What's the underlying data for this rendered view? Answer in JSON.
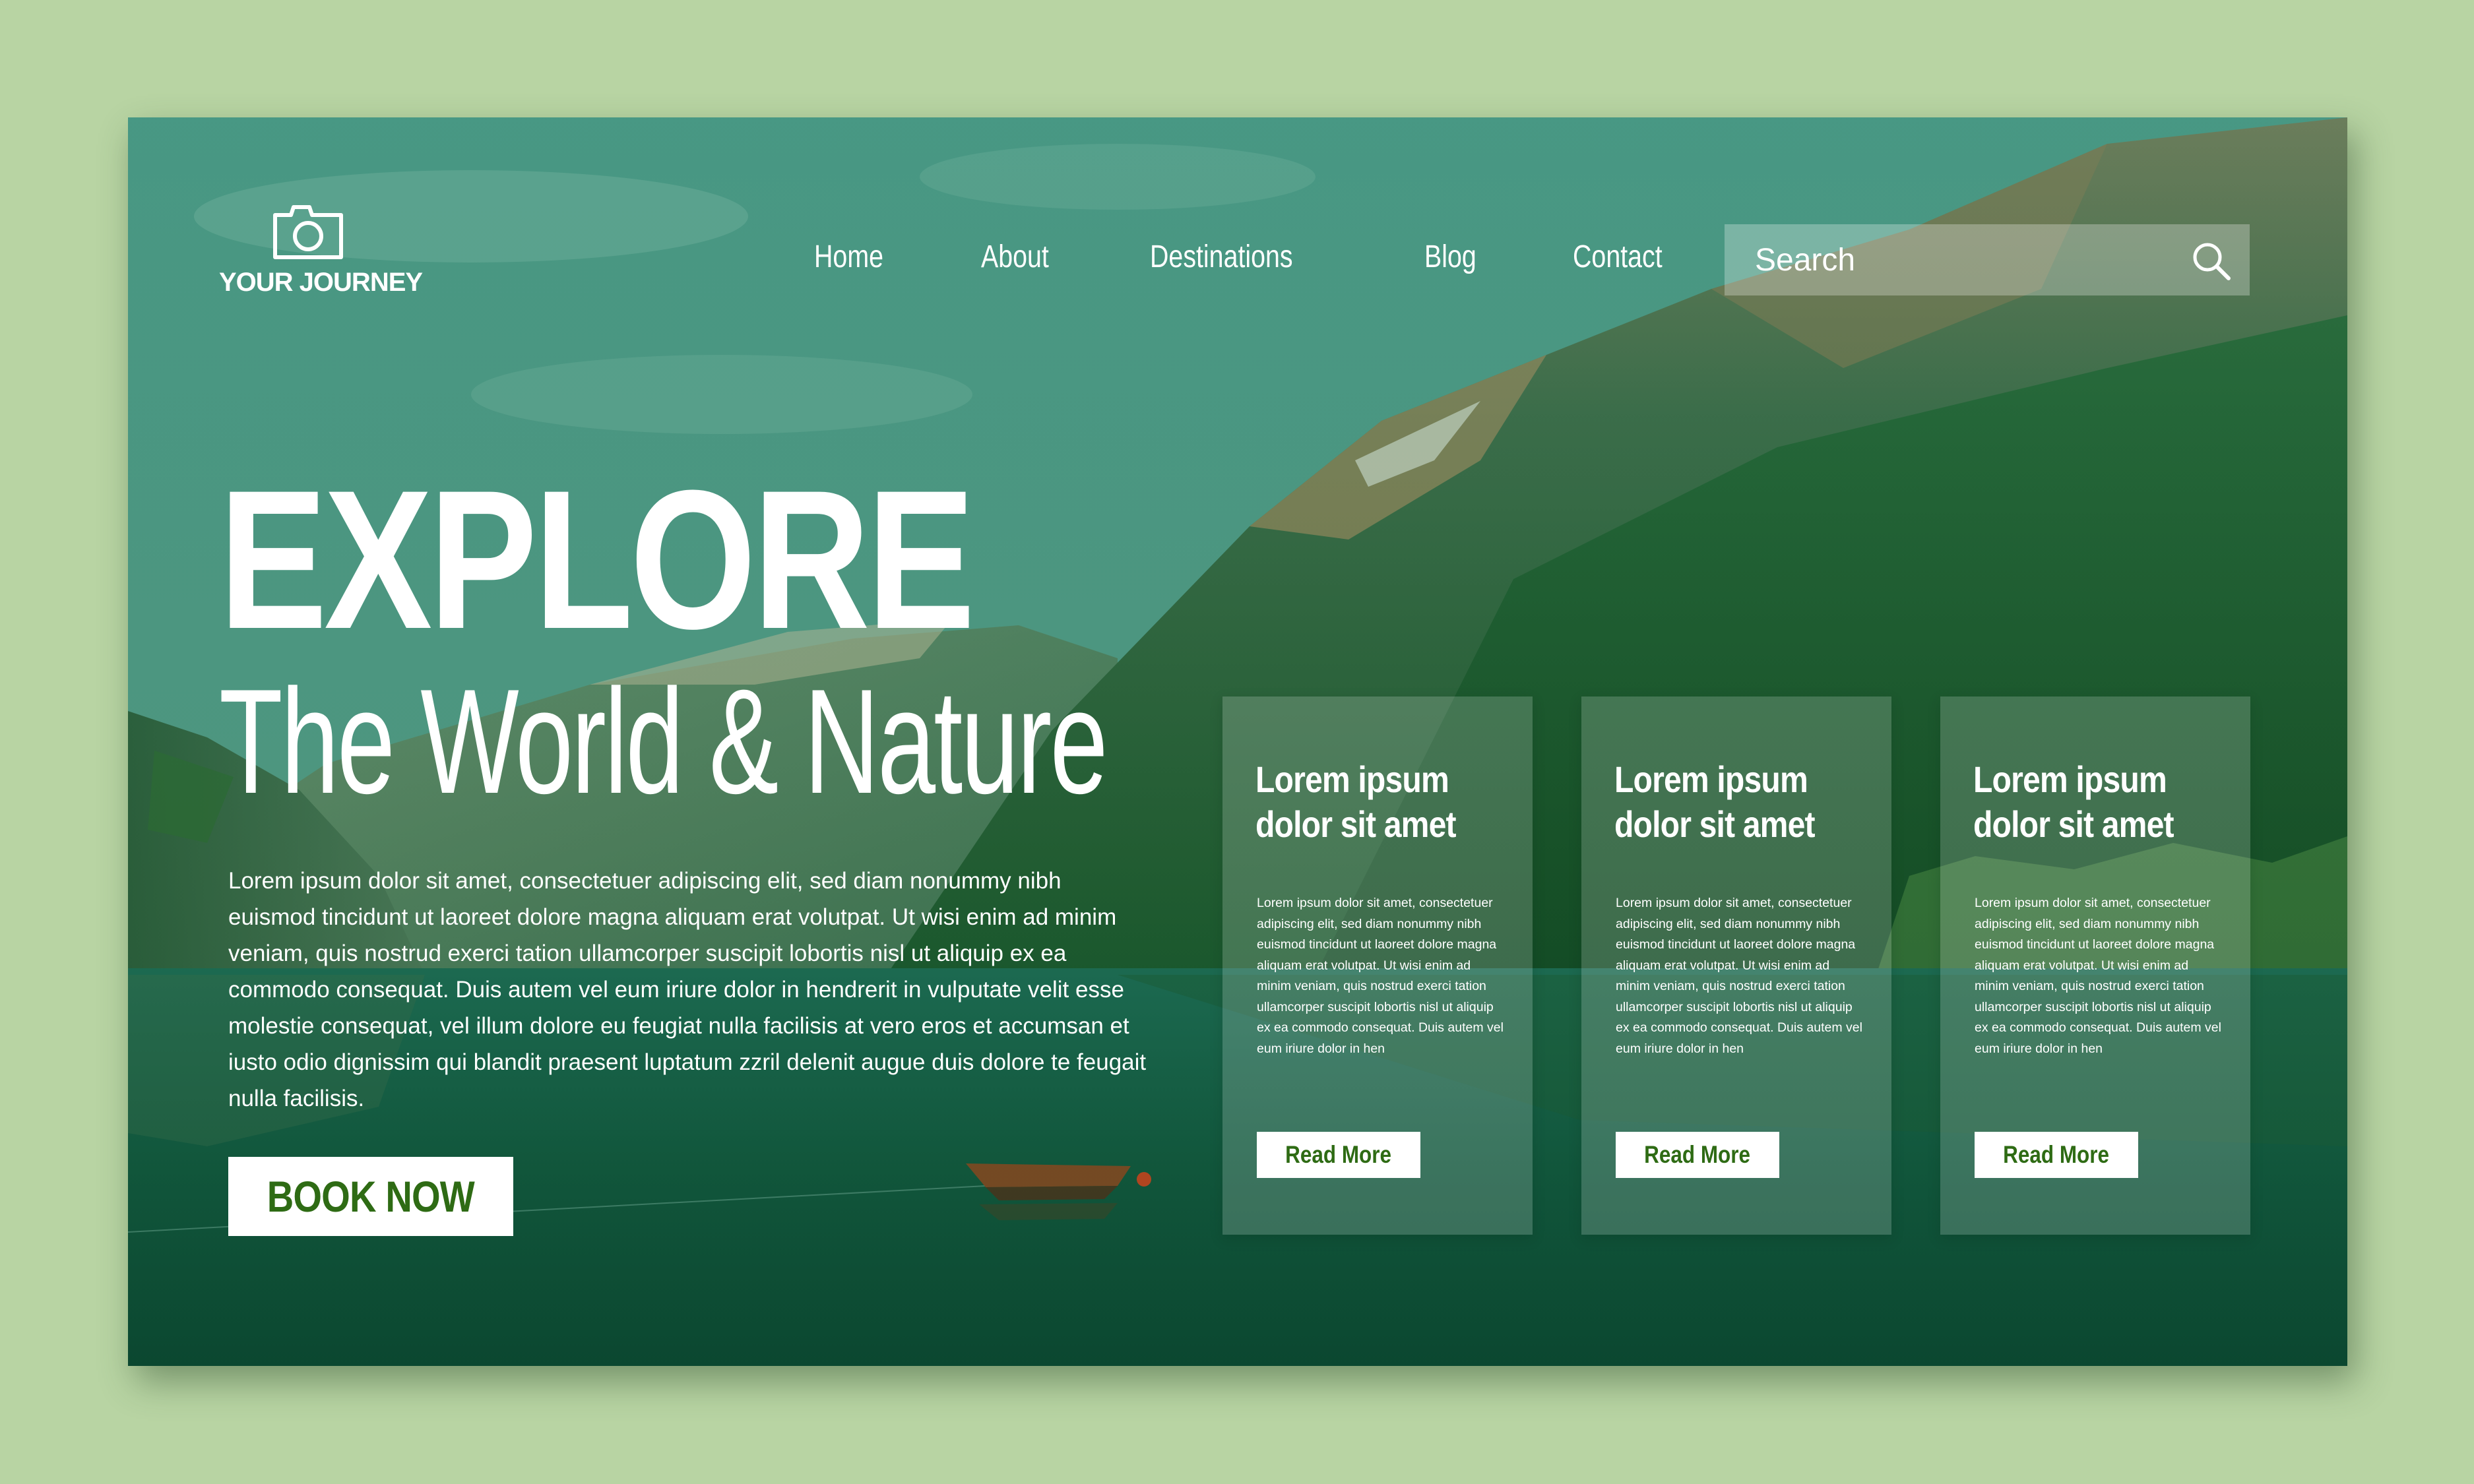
{
  "brand": {
    "logo_icon": "camera-icon",
    "name": "YOUR JOURNEY"
  },
  "nav": {
    "items": [
      {
        "label": "Home"
      },
      {
        "label": "About"
      },
      {
        "label": "Destinations"
      },
      {
        "label": "Blog"
      },
      {
        "label": "Contact"
      }
    ]
  },
  "search": {
    "placeholder": "Search",
    "value": "",
    "icon": "search-icon"
  },
  "hero": {
    "headline": "EXPLORE",
    "subheadline": "The World & Nature",
    "body": "Lorem ipsum dolor sit amet, consectetuer adipiscing elit, sed diam nonummy nibh euismod tincidunt ut laoreet dolore magna aliquam erat volutpat. Ut wisi enim ad minim veniam, quis nostrud exerci tation ullamcorper suscipit lobortis nisl ut aliquip ex ea commodo consequat. Duis autem vel eum iriure dolor in hendrerit in vulputate velit esse molestie consequat, vel illum dolore eu feugiat nulla facilisis at vero eros et accumsan et iusto odio dignissim qui blandit praesent luptatum zzril delenit augue duis dolore te feugait nulla facilisis.",
    "cta_label": "BOOK NOW"
  },
  "cards": [
    {
      "title": "Lorem ipsum dolor sit amet",
      "body": "Lorem ipsum dolor sit amet, consectetuer adipiscing elit, sed diam nonummy nibh euismod tincidunt ut laoreet dolore magna aliquam erat volutpat. Ut wisi enim ad minim veniam, quis nostrud exerci tation ullamcorper suscipit lobortis nisl ut aliquip ex ea commodo consequat. Duis autem vel eum iriure dolor in hen",
      "button_label": "Read More"
    },
    {
      "title": "Lorem ipsum dolor sit amet",
      "body": "Lorem ipsum dolor sit amet, consectetuer adipiscing elit, sed diam nonummy nibh euismod tincidunt ut laoreet dolore magna aliquam erat volutpat. Ut wisi enim ad minim veniam, quis nostrud exerci tation ullamcorper suscipit lobortis nisl ut aliquip ex ea commodo consequat. Duis autem vel eum iriure dolor in hen",
      "button_label": "Read More"
    },
    {
      "title": "Lorem ipsum dolor sit amet",
      "body": "Lorem ipsum dolor sit amet, consectetuer adipiscing elit, sed diam nonummy nibh euismod tincidunt ut laoreet dolore magna aliquam erat volutpat. Ut wisi enim ad minim veniam, quis nostrud exerci tation ullamcorper suscipit lobortis nisl ut aliquip ex ea commodo consequat. Duis autem vel eum iriure dolor in hen",
      "button_label": "Read More"
    }
  ],
  "colors": {
    "page_background": "#b8d4a3",
    "button_text": "#2e6b14",
    "button_background": "#ffffff",
    "overlay_teal": "#2f7a66"
  }
}
